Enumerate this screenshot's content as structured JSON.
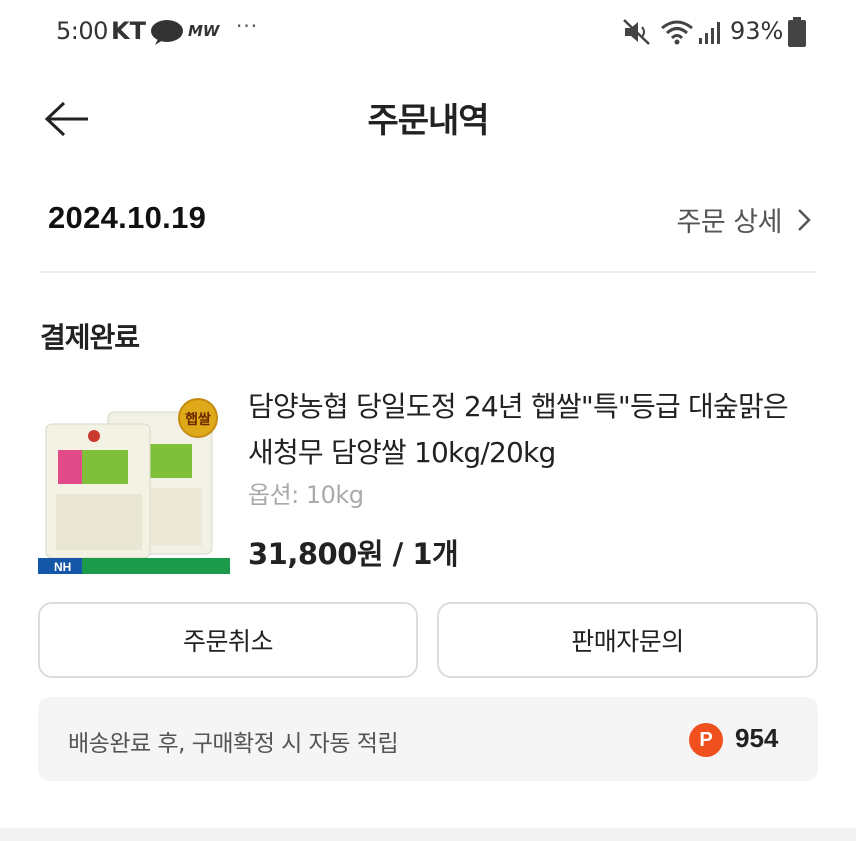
{
  "status_bar": {
    "time": "5:00",
    "carrier": "KT",
    "extra_label": "MW",
    "dots": "···",
    "battery": "93%"
  },
  "header": {
    "title": "주문내역",
    "back_icon": "arrow-left-icon"
  },
  "order": {
    "date": "2024.10.19",
    "detail_label": "주문 상세",
    "detail_icon": "chevron-right-icon",
    "status": "결제완료"
  },
  "product": {
    "name": "담양농협 당일도정 24년 햅쌀\"특\"등급 대숲맑은 새청무 담양쌀 10kg/20kg",
    "option": "옵션: 10kg",
    "price": "31,800원 / 1개",
    "image_badge": "햅쌀",
    "image_brand": "NH"
  },
  "actions": {
    "cancel_label": "주문취소",
    "inquiry_label": "판매자문의"
  },
  "points": {
    "description": "배송완료 후, 구매확정 시 자동 적립",
    "icon_letter": "P",
    "value": "954"
  },
  "colors": {
    "accent_points": "#f0501e",
    "text_primary": "#222222",
    "text_muted": "#aaaaaa"
  }
}
